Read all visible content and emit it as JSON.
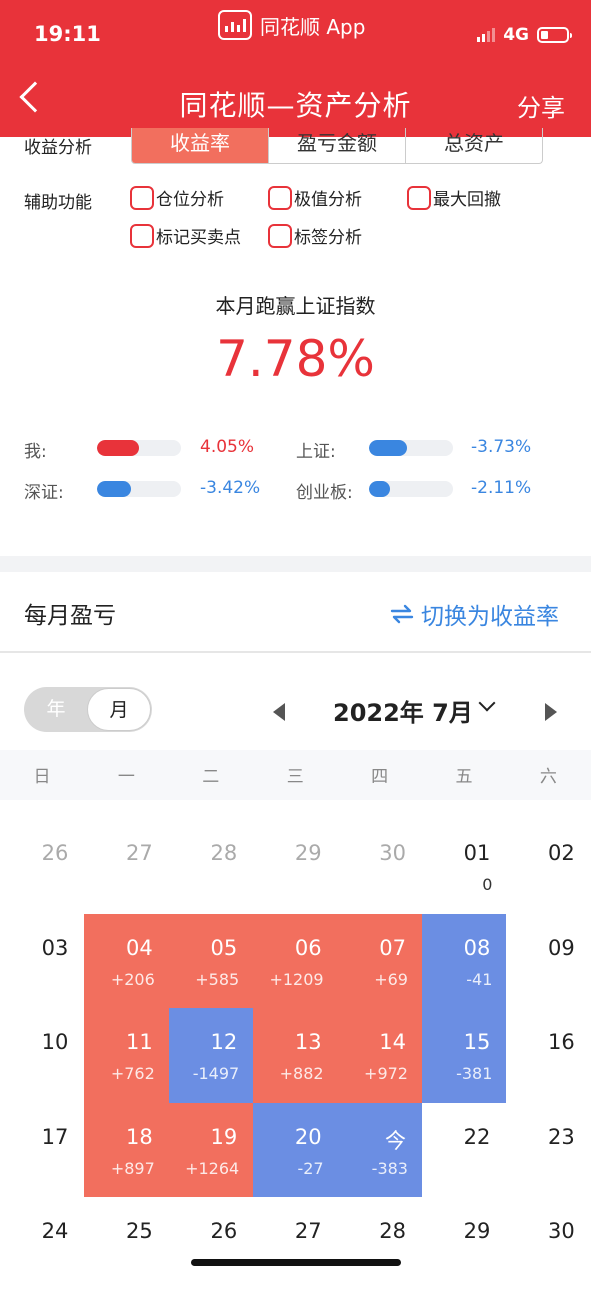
{
  "status": {
    "time": "19:11",
    "app_name": "同花顺 App",
    "network": "4G"
  },
  "nav": {
    "title": "同花顺—资产分析",
    "share": "分享"
  },
  "analysis": {
    "label": "收益分析",
    "tabs": [
      "收益率",
      "盈亏金额",
      "总资产"
    ],
    "active_tab": "收益率"
  },
  "aux": {
    "label": "辅助功能",
    "options": [
      "仓位分析",
      "极值分析",
      "最大回撤",
      "标记买卖点",
      "标签分析"
    ]
  },
  "beat": {
    "title": "本月跑赢上证指数",
    "value": "7.78%"
  },
  "comparisons": [
    {
      "label": "我:",
      "value": "4.05%",
      "fill": 0.5,
      "color": "#e8333a"
    },
    {
      "label": "上证:",
      "value": "-3.73%",
      "fill": 0.45,
      "color": "#3a86e0"
    },
    {
      "label": "深证:",
      "value": "-3.42%",
      "fill": 0.4,
      "color": "#3a86e0"
    },
    {
      "label": "创业板:",
      "value": "-2.11%",
      "fill": 0.25,
      "color": "#3a86e0"
    }
  ],
  "monthly": {
    "title": "每月盈亏",
    "switch_label": "切换为收益率"
  },
  "toggle": {
    "year": "年",
    "month": "月"
  },
  "calendar": {
    "month_title": "2022年 7月",
    "weekdays": [
      "日",
      "一",
      "二",
      "三",
      "四",
      "五",
      "六"
    ],
    "cells": [
      {
        "day": "26",
        "type": "muted"
      },
      {
        "day": "27",
        "type": "muted"
      },
      {
        "day": "28",
        "type": "muted"
      },
      {
        "day": "29",
        "type": "muted"
      },
      {
        "day": "30",
        "type": "muted"
      },
      {
        "day": "01",
        "type": "plain",
        "pnl": "0"
      },
      {
        "day": "02",
        "type": "plain"
      },
      {
        "day": "03",
        "type": "plain"
      },
      {
        "day": "04",
        "type": "pos",
        "pnl": "+206"
      },
      {
        "day": "05",
        "type": "pos",
        "pnl": "+585"
      },
      {
        "day": "06",
        "type": "pos",
        "pnl": "+1209"
      },
      {
        "day": "07",
        "type": "pos",
        "pnl": "+69"
      },
      {
        "day": "08",
        "type": "neg",
        "pnl": "-41"
      },
      {
        "day": "09",
        "type": "plain"
      },
      {
        "day": "10",
        "type": "plain"
      },
      {
        "day": "11",
        "type": "pos",
        "pnl": "+762"
      },
      {
        "day": "12",
        "type": "neg",
        "pnl": "-1497"
      },
      {
        "day": "13",
        "type": "pos",
        "pnl": "+882"
      },
      {
        "day": "14",
        "type": "pos",
        "pnl": "+972"
      },
      {
        "day": "15",
        "type": "neg",
        "pnl": "-381"
      },
      {
        "day": "16",
        "type": "plain"
      },
      {
        "day": "17",
        "type": "plain"
      },
      {
        "day": "18",
        "type": "pos",
        "pnl": "+897"
      },
      {
        "day": "19",
        "type": "pos",
        "pnl": "+1264"
      },
      {
        "day": "20",
        "type": "neg",
        "pnl": "-27"
      },
      {
        "day": "今",
        "type": "neg",
        "pnl": "-383"
      },
      {
        "day": "22",
        "type": "plain"
      },
      {
        "day": "23",
        "type": "plain"
      },
      {
        "day": "24",
        "type": "plain"
      },
      {
        "day": "25",
        "type": "plain"
      },
      {
        "day": "26",
        "type": "plain"
      },
      {
        "day": "27",
        "type": "plain"
      },
      {
        "day": "28",
        "type": "plain"
      },
      {
        "day": "29",
        "type": "plain"
      },
      {
        "day": "30",
        "type": "plain"
      }
    ]
  }
}
